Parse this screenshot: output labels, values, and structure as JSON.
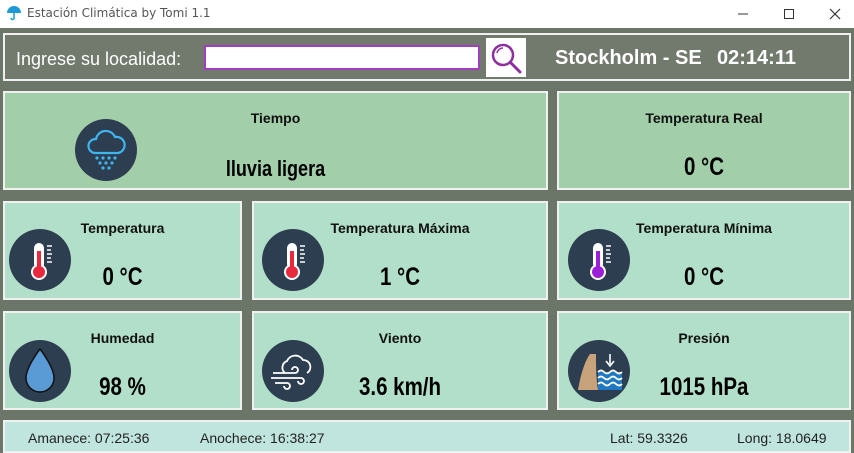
{
  "window": {
    "title": "Estación Climática by Tomi 1.1"
  },
  "search": {
    "label": "Ingrese su localidad:",
    "value": "",
    "placeholder": ""
  },
  "header": {
    "location": "Stockholm - SE",
    "time": "02:14:11"
  },
  "cards": {
    "tiempo": {
      "title": "Tiempo",
      "value": "lluvia ligera",
      "icon": "rain-cloud-icon"
    },
    "temp_real": {
      "title": "Temperatura Real",
      "value": "0 °C"
    },
    "temperatura": {
      "title": "Temperatura",
      "value": "0 °C",
      "icon": "thermometer-icon"
    },
    "temp_max": {
      "title": "Temperatura Máxima",
      "value": "1 °C",
      "icon": "thermometer-icon"
    },
    "temp_min": {
      "title": "Temperatura Mínima",
      "value": "0 °C",
      "icon": "thermometer-icon"
    },
    "humedad": {
      "title": "Humedad",
      "value": "98 %",
      "icon": "water-drop-icon"
    },
    "viento": {
      "title": "Viento",
      "value": "3.6 km/h",
      "icon": "wind-icon"
    },
    "presion": {
      "title": "Presión",
      "value": "1015 hPa",
      "icon": "pressure-icon"
    }
  },
  "footer": {
    "sunrise": "Amanece: 07:25:36",
    "sunset": "Anochece: 16:38:27",
    "lat": "Lat: 59.3326",
    "long": "Long: 18.0649"
  },
  "colors": {
    "background": "#6b7568",
    "card_light": "#b2dfc9",
    "card_dark": "#a2cea9",
    "icon_bg": "#2c3e50",
    "input_border": "#a040c0",
    "footer_bg": "#c0e5df"
  }
}
